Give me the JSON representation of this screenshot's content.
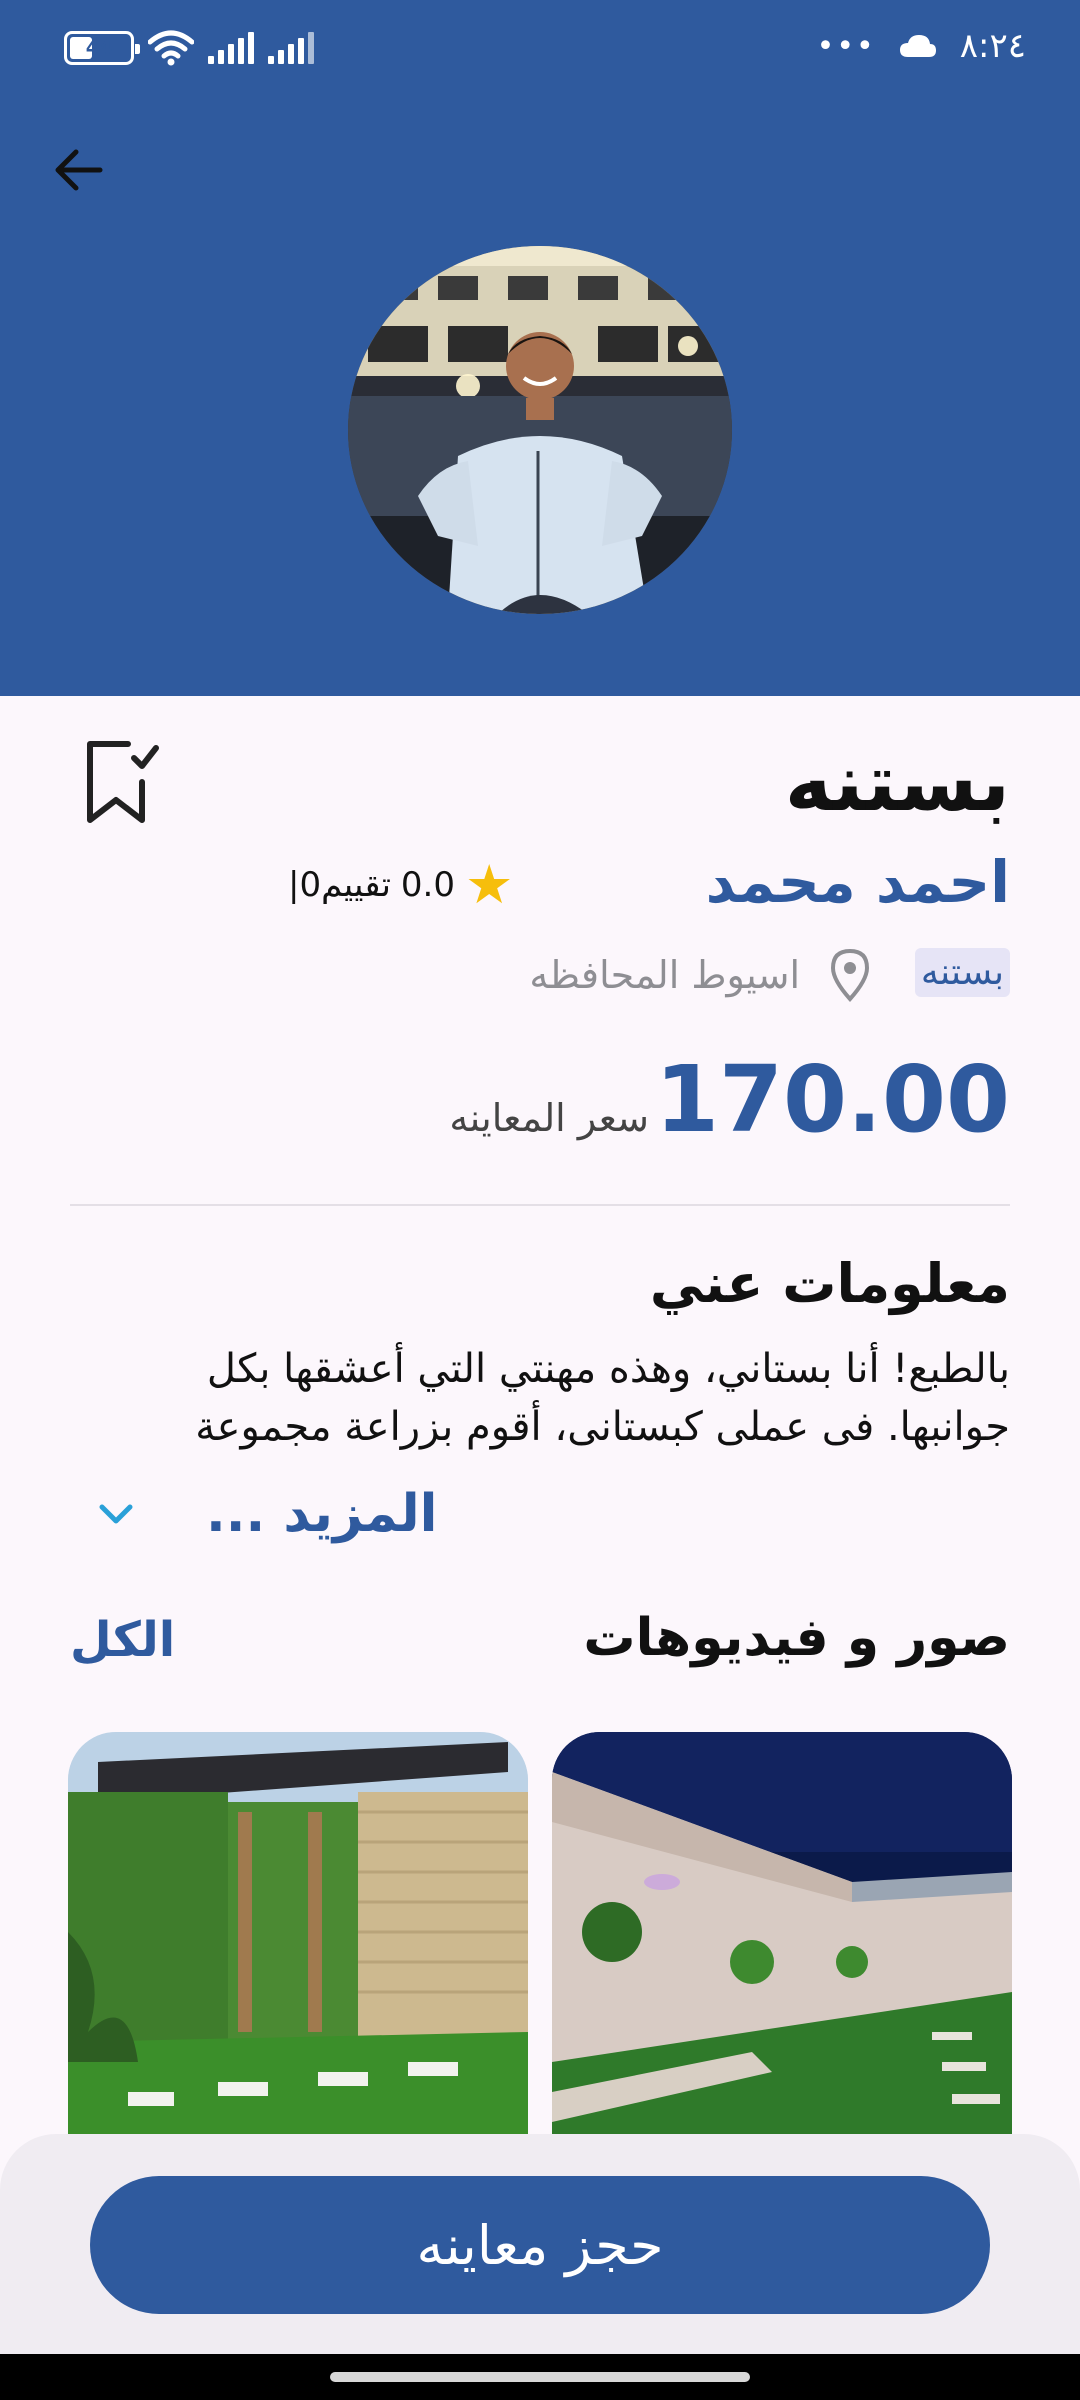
{
  "status_bar": {
    "time": "٨:٢٤",
    "battery": "44",
    "battery_level": 0.44,
    "more_indicator": "•••",
    "icons": [
      "battery-icon",
      "wifi-icon",
      "signal-icon",
      "signal-icon",
      "cloud-icon"
    ]
  },
  "header": {
    "back_icon": "arrow-left-icon",
    "background_color": "#2f5a9e"
  },
  "service": {
    "title": "بستنه",
    "provider_name": "احمد محمد",
    "rating_value": "0.0",
    "rating_text": "|0تقييم",
    "category_tag": "بستنه",
    "location": "اسيوط المحافظه",
    "price": "170.00",
    "price_label": "سعر المعاينه",
    "bookmark_icon": "bookmark-check-icon"
  },
  "about": {
    "title": "معلومات عني",
    "text": "بالطبع! أنا بستاني، وهذه مهنتي التي أعشقها بكل جوانبها. فى عملى كبستانى، أقوم بزراعة مجموعة",
    "more_label": "المزيد ...",
    "more_icon": "chevron-down-icon"
  },
  "media": {
    "title": "صور و فيديوهات",
    "all_label": "الكل"
  },
  "actions": {
    "book_label": "حجز معاينه"
  },
  "colors": {
    "primary": "#2f5a9e",
    "star": "#f6be0c",
    "tag_bg": "#e6e4f6",
    "page_bg": "#fcf7fc"
  }
}
